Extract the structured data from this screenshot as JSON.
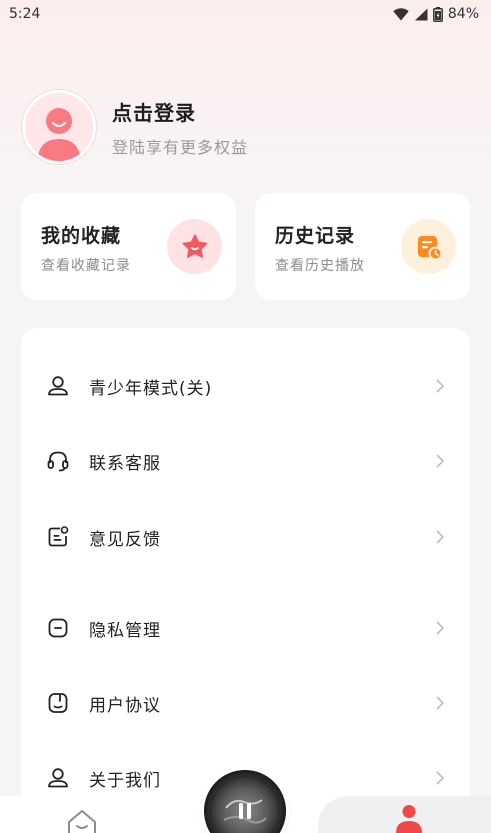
{
  "status_bar": {
    "time": "5:24",
    "battery": "84%",
    "icons": [
      "wifi-icon",
      "signal-icon",
      "battery-icon"
    ]
  },
  "profile": {
    "title": "点击登录",
    "subtitle": "登陆享有更多权益",
    "avatar_icon": "user-avatar-icon"
  },
  "cards": {
    "favorites": {
      "title": "我的收藏",
      "subtitle": "查看收藏记录",
      "icon": "star-icon",
      "icon_color": "#f25a61"
    },
    "history": {
      "title": "历史记录",
      "subtitle": "查看历史播放",
      "icon": "history-clock-icon",
      "icon_color": "#ff8a1f"
    }
  },
  "menu": {
    "items": [
      {
        "label": "青少年模式(关)",
        "icon": "teen-mode-icon"
      },
      {
        "label": "联系客服",
        "icon": "headset-icon"
      },
      {
        "label": "意见反馈",
        "icon": "feedback-icon"
      },
      {
        "label": "隐私管理",
        "icon": "privacy-icon"
      },
      {
        "label": "用户协议",
        "icon": "agreement-icon"
      },
      {
        "label": "关于我们",
        "icon": "about-icon"
      }
    ]
  },
  "bottom_nav": {
    "home_icon": "home-icon",
    "mine_icon": "person-icon",
    "player_icon": "pause-icon",
    "accent": "#f04848"
  }
}
